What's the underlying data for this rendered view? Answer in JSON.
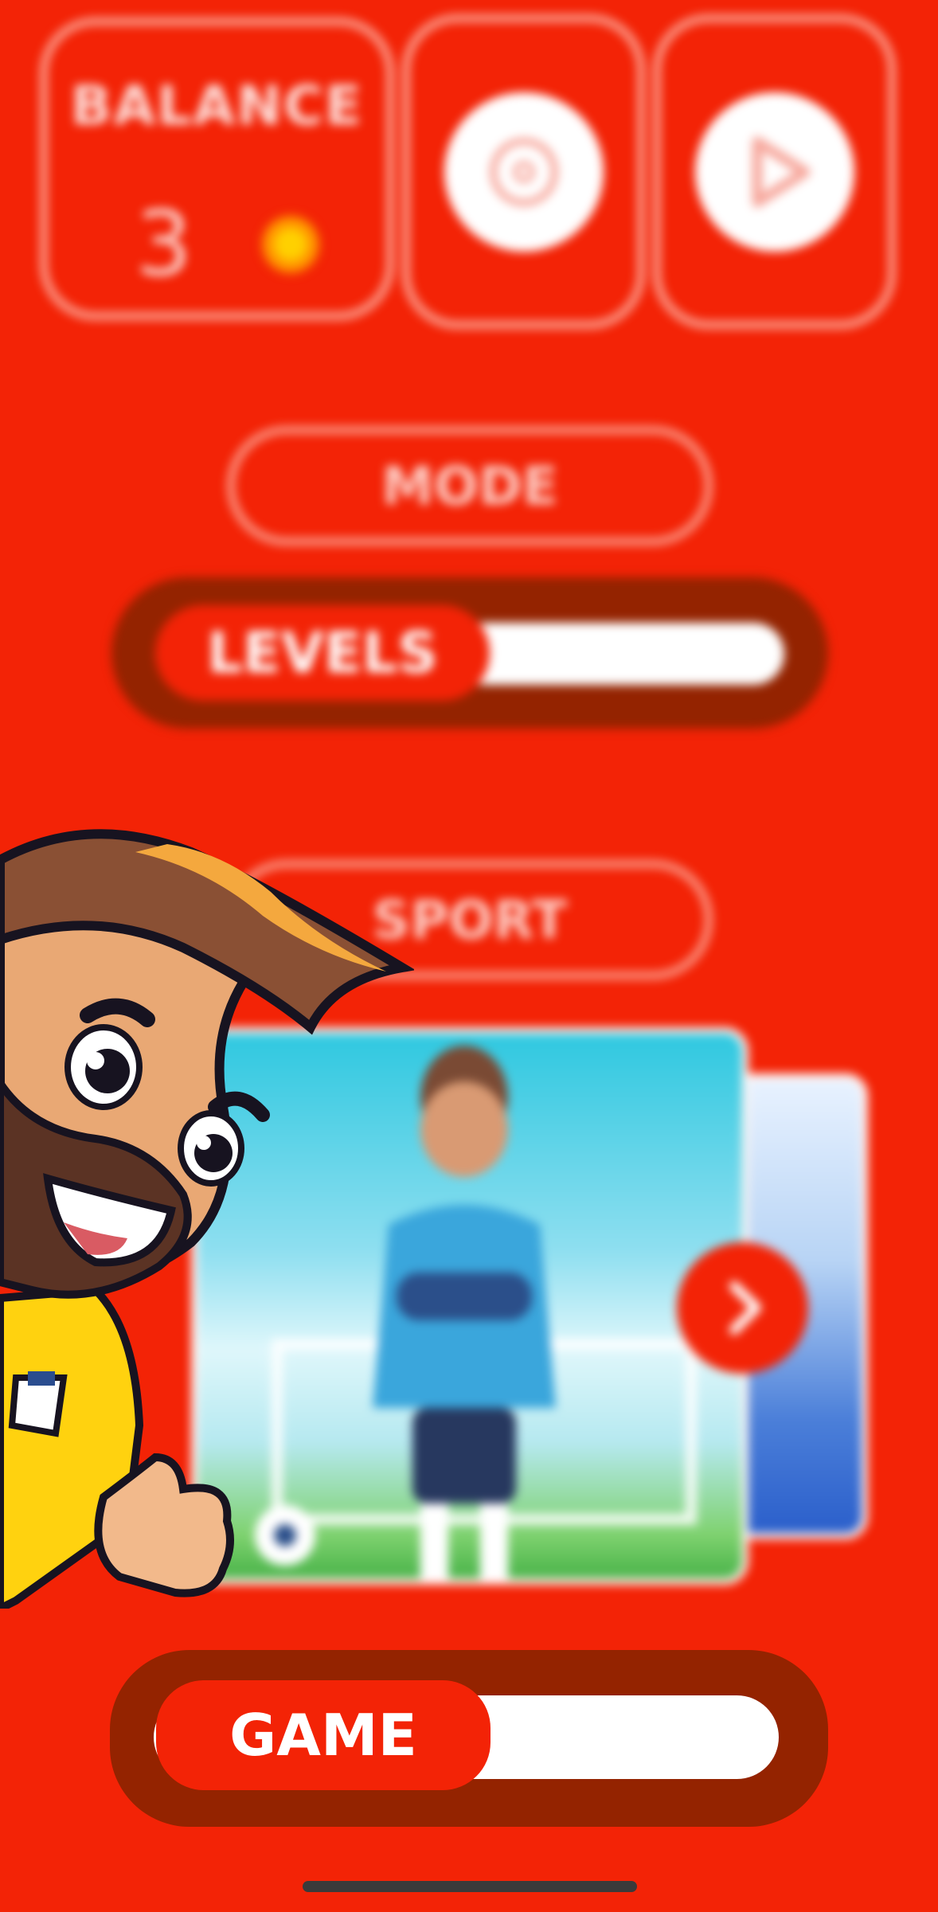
{
  "balance": {
    "title": "BALANCE",
    "value": "3",
    "currency_icon": "sun-icon"
  },
  "top_buttons": [
    {
      "name": "settings-button",
      "icon": "gear-icon"
    },
    {
      "name": "play-button",
      "icon": "play-icon"
    }
  ],
  "mode": {
    "label": "MODE"
  },
  "levels_toggle": {
    "label": "LEVELS"
  },
  "sport": {
    "label": "SPORT"
  },
  "carousel": {
    "next_icon": "chevron-right-icon"
  },
  "game_toggle": {
    "label": "GAME"
  },
  "colors": {
    "background": "#f32306",
    "track": "#942300",
    "knob": "#f32306",
    "white": "#ffffff"
  }
}
